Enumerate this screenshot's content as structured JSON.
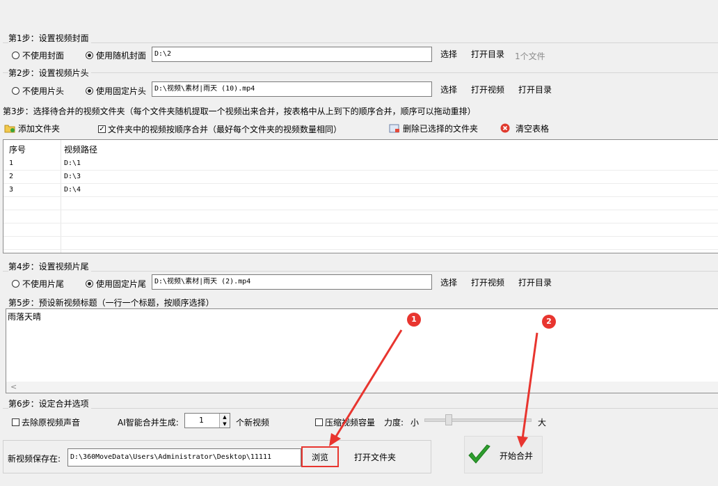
{
  "step1": {
    "title": "第1步：设置视频封面",
    "radio_none": "不使用封面",
    "radio_random": "使用随机封面",
    "path_value": "D:\\2",
    "select_label": "选择",
    "open_dir_label": "打开目录",
    "file_count": "1个文件"
  },
  "step2": {
    "title": "第2步：设置视频片头",
    "radio_none": "不使用片头",
    "radio_fixed": "使用固定片头",
    "path_value": "D:\\视频\\素材|雨天 (10).mp4",
    "select_label": "选择",
    "open_video_label": "打开视频",
    "open_dir_label": "打开目录"
  },
  "step3": {
    "title": "第3步：选择待合并的视频文件夹（每个文件夹随机提取一个视频出来合并，按表格中从上到下的顺序合并，顺序可以拖动重排）",
    "add_folder_label": "添加文件夹",
    "order_merge_label": "文件夹中的视频按顺序合并（最好每个文件夹的视频数量相同）",
    "delete_selected_label": "删除已选择的文件夹",
    "clear_table_label": "清空表格",
    "table": {
      "headers": [
        "序号",
        "视频路径"
      ],
      "rows": [
        {
          "index": "1",
          "path": "D:\\1"
        },
        {
          "index": "2",
          "path": "D:\\3"
        },
        {
          "index": "3",
          "path": "D:\\4"
        }
      ]
    }
  },
  "step4": {
    "title": "第4步：设置视频片尾",
    "radio_none": "不使用片尾",
    "radio_fixed": "使用固定片尾",
    "path_value": "D:\\视频\\素材|雨天 (2).mp4",
    "select_label": "选择",
    "open_video_label": "打开视频",
    "open_dir_label": "打开目录"
  },
  "step5": {
    "title": "第5步：预设新视频标题（一行一个标题，按顺序选择）",
    "text_value": "雨落天晴",
    "scroll_arrow": "<"
  },
  "step6": {
    "title": "第6步：设定合并选项",
    "remove_audio_label": "去除原视频声音",
    "ai_label": "AI智能合并生成:",
    "ai_count": "1",
    "new_video_unit": "个新视频",
    "compress_label": "压缩视频容量",
    "strength_label": "力度:",
    "small_label": "小",
    "large_label": "大"
  },
  "output": {
    "save_label": "新视频保存在:",
    "path_value": "D:\\360MoveData\\Users\\Administrator\\Desktop\\11111",
    "browse_label": "浏览",
    "open_folder_label": "打开文件夹"
  },
  "start_label": "开始合并",
  "annotations": {
    "badge1": "1",
    "badge2": "2"
  },
  "colors": {
    "annotation_red": "#e8352f",
    "check_green": "#2e9e2e"
  }
}
